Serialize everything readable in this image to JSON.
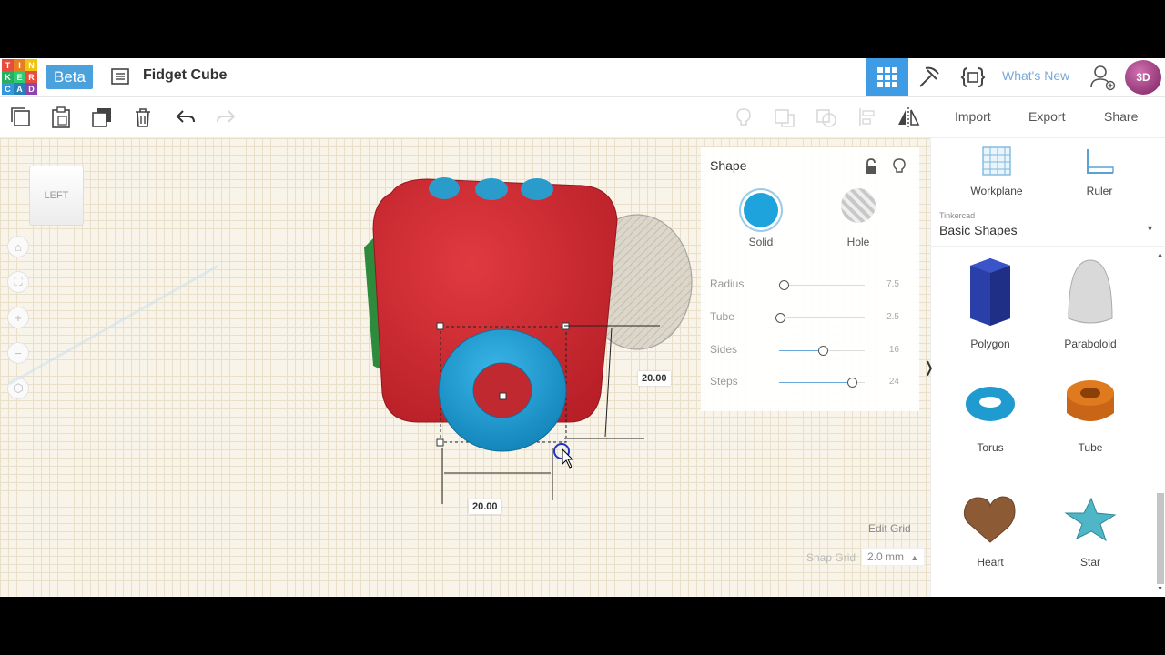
{
  "header": {
    "logo_letters": [
      "T",
      "I",
      "N",
      "K",
      "E",
      "R",
      "C",
      "A",
      "D"
    ],
    "logo_colors": [
      "#e74c3c",
      "#e67e22",
      "#f1c40f",
      "#27ae60",
      "#2ecc71",
      "#e74c3c",
      "#3498db",
      "#2980b9",
      "#8e44ad"
    ],
    "beta_label": "Beta",
    "design_title": "Fidget Cube",
    "whats_new": "What's New",
    "avatar_text": "3D"
  },
  "toolbar": {
    "import": "Import",
    "export": "Export",
    "share": "Share"
  },
  "viewcube": {
    "face_label": "LEFT"
  },
  "inspector": {
    "title": "Shape",
    "solid_label": "Solid",
    "hole_label": "Hole",
    "props": [
      {
        "label": "Radius",
        "value": "7.5",
        "fill": 0.04
      },
      {
        "label": "Tube",
        "value": "2.5",
        "fill": 0.0
      },
      {
        "label": "Sides",
        "value": "16",
        "fill": 0.5
      },
      {
        "label": "Steps",
        "value": "24",
        "fill": 0.85
      }
    ]
  },
  "workplane": {
    "dim_width": "20.00",
    "dim_height": "20.00",
    "edit_grid": "Edit Grid",
    "snap_grid_label": "Snap Grid",
    "snap_grid_value": "2.0 mm"
  },
  "right_panel": {
    "workplane_label": "Workplane",
    "ruler_label": "Ruler",
    "library_source": "Tinkercad",
    "library_title": "Basic Shapes",
    "shapes": [
      "Polygon",
      "Paraboloid",
      "Torus",
      "Tube",
      "Heart",
      "Star"
    ]
  },
  "colors": {
    "accent": "#3f9ce4",
    "cube_red": "#d42b32",
    "torus_blue": "#1f9bd0",
    "tube_orange": "#e07a1f"
  }
}
